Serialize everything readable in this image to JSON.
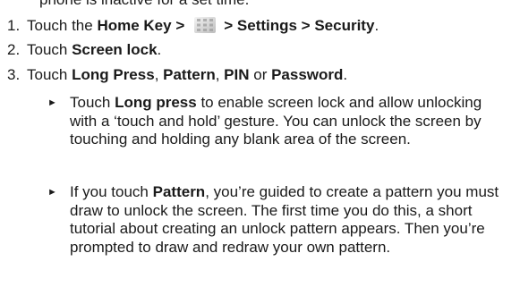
{
  "top_line": "phone is inactive for a set time.",
  "steps": [
    {
      "number": "1.",
      "prefix": "Touch the ",
      "bold1": "Home Key >",
      "icon": "apps-grid-icon",
      "bold2": "> Settings > Security",
      "suffix": "."
    },
    {
      "number": "2.",
      "prefix": "Touch ",
      "bold1": "Screen lock",
      "suffix": "."
    },
    {
      "number": "3.",
      "prefix": "Touch ",
      "bold1": "Long Press",
      "sep1": ", ",
      "bold2": "Pattern",
      "sep2": ", ",
      "bold3": "PIN",
      "sep3": " or ",
      "bold4": "Password",
      "suffix": "."
    }
  ],
  "bullets": [
    {
      "marker": "►",
      "prefix": "Touch ",
      "bold": "Long press",
      "rest": " to enable screen lock and allow unlocking with a ‘touch and hold’ gesture. You can unlock the screen by touching and holding any blank area of the screen."
    },
    {
      "marker": "►",
      "prefix": "If you touch ",
      "bold": "Pattern",
      "rest": ", you’re guided to create a pattern you must draw to unlock the screen. The first time you do this, a short tutorial about creating an unlock pattern appears. Then you’re prompted to draw and redraw your own pattern."
    }
  ]
}
